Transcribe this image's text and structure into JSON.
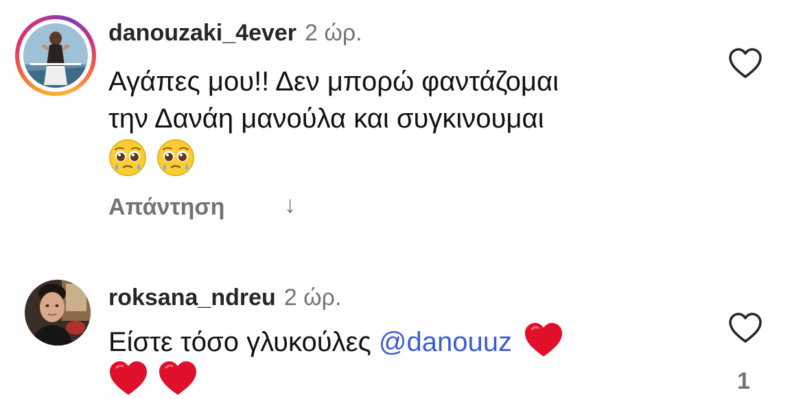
{
  "comments": [
    {
      "username": "danouzaki_4ever",
      "time": "2 ώρ.",
      "line1": "Αγάπες μου!! Δεν μπορώ φαντάζομαι",
      "line2": "την Δανάη μανούλα και συγκινουμαι",
      "emojis": [
        "pleading-face",
        "pleading-face"
      ],
      "reply_label": "Απάντηση",
      "reply_arrow": "↓",
      "has_story_ring": true
    },
    {
      "username": "roksana_ndreu",
      "time": "2 ώρ.",
      "text_before_mention": "Είστε τόσο γλυκούλες",
      "mention": "@danouuz",
      "emojis": [
        "red-heart",
        "red-heart",
        "red-heart"
      ],
      "like_count": "1",
      "has_story_ring": false
    }
  ],
  "colors": {
    "mention": "#3b5bdb",
    "secondary_text": "#737373",
    "heart": "#e0102a"
  }
}
